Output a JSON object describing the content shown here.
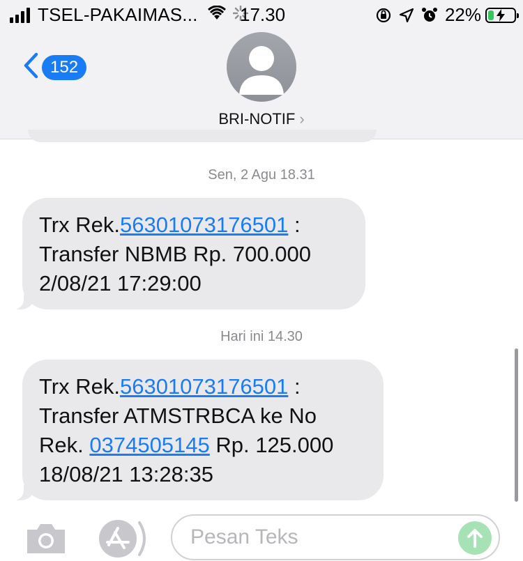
{
  "status_bar": {
    "carrier": "TSEL-PAKAIMAS...",
    "time": "17.30",
    "battery_percent": "22%",
    "battery_level": 0.22,
    "icons": [
      "signal-icon",
      "wifi-icon",
      "activity-icon",
      "orientation-lock-icon",
      "location-icon",
      "alarm-icon",
      "battery-charging-icon"
    ]
  },
  "nav": {
    "back_count": "152",
    "contact_name": "BRI-NOTIF",
    "contact_chevron": "›"
  },
  "messages": [
    {
      "timestamp": "Sen, 2 Agu 18.31",
      "lines": {
        "l1_pre": "Trx Rek.",
        "l1_link": "56301073176501",
        "l1_post": " :",
        "l2": "Transfer  NBMB Rp. 700.000",
        "l3": "2/08/21 17:29:00"
      }
    },
    {
      "timestamp": "Hari ini 14.30",
      "lines": {
        "l1_pre": "Trx Rek.",
        "l1_link": "56301073176501",
        "l1_post": " :",
        "l2": "Transfer  ATMSTRBCA ke No",
        "l3_pre": "Rek. ",
        "l3_link": "0374505145",
        "l3_post": " Rp. 125.000",
        "l4": "18/08/21 13:28:35"
      }
    }
  ],
  "input": {
    "placeholder": "Pesan Teks"
  },
  "colors": {
    "accent": "#1a7cf5",
    "bubble": "#e9e9eb",
    "send_button": "#a7e2b6"
  }
}
